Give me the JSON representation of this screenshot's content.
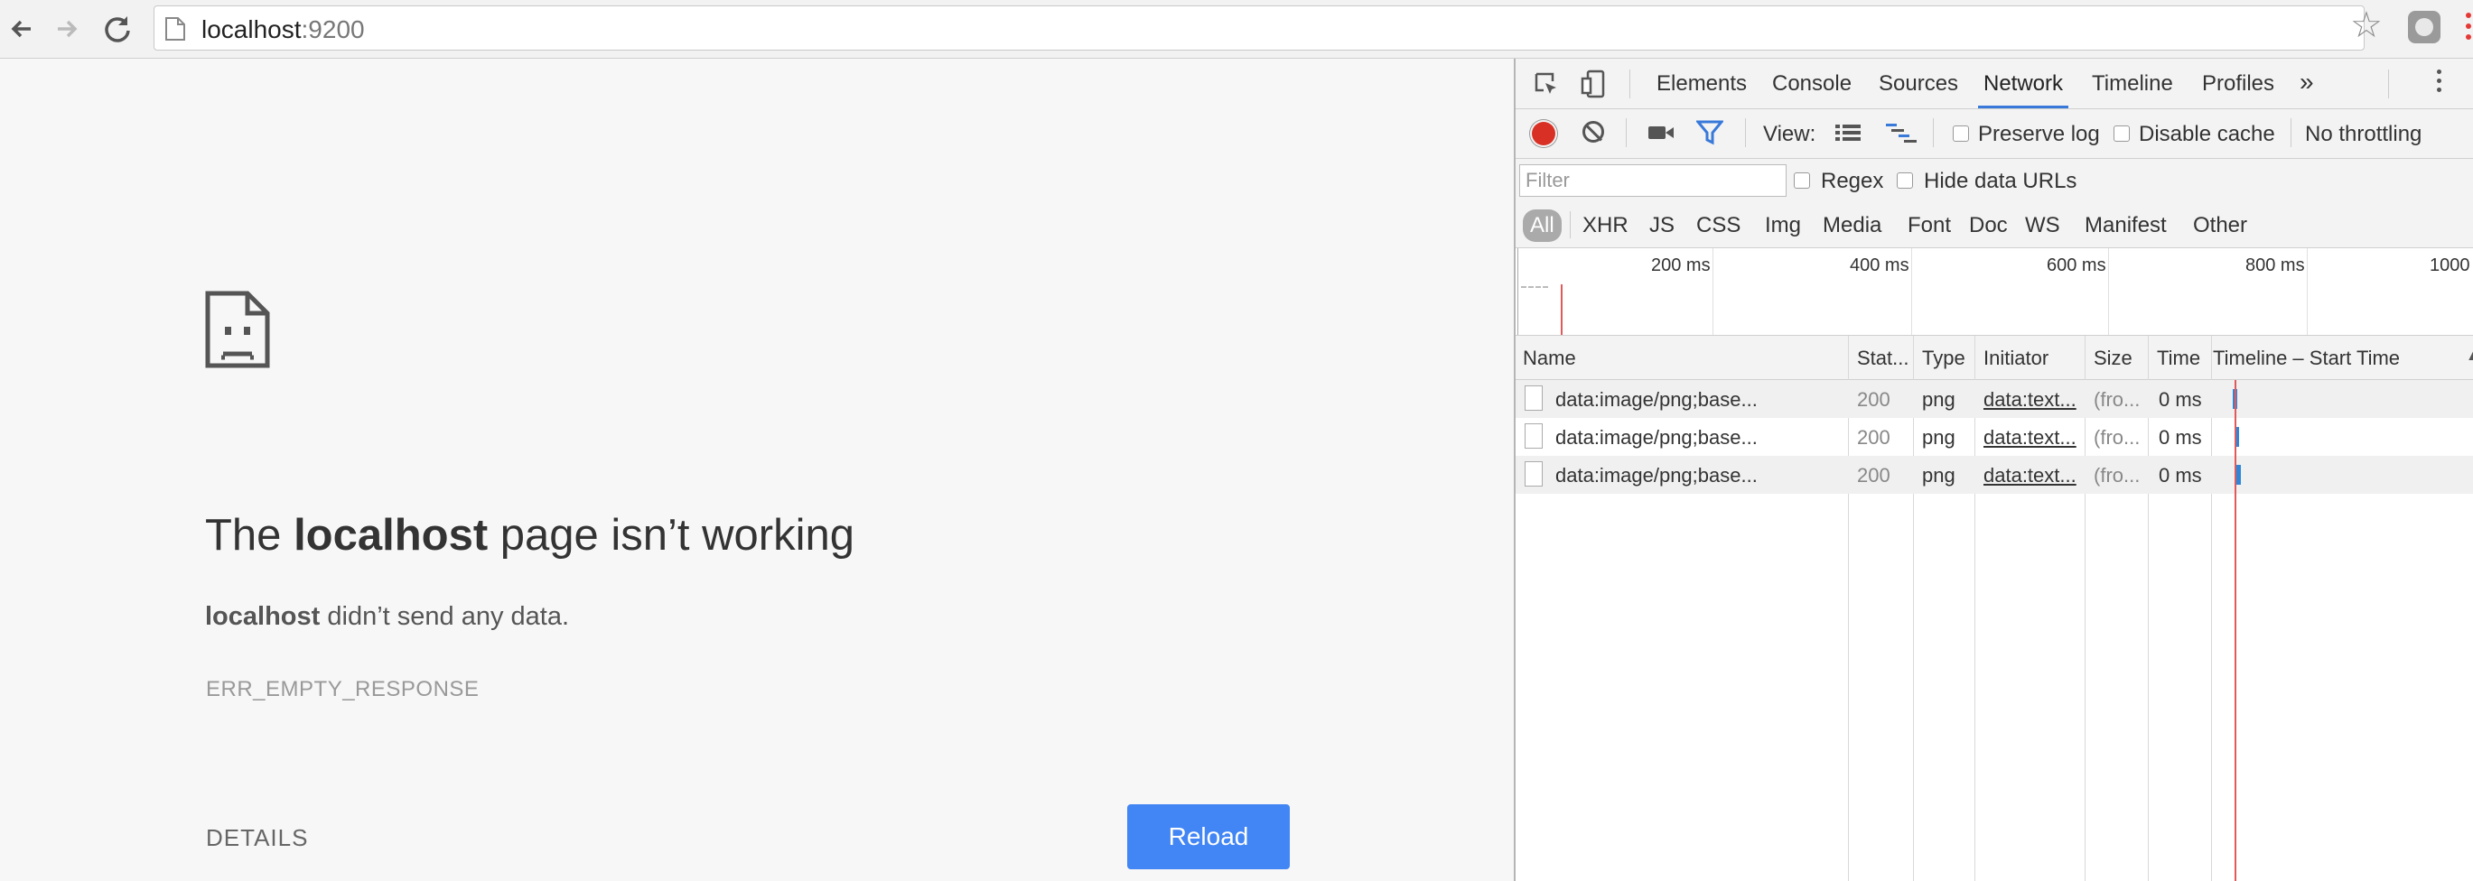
{
  "browser": {
    "url_host": "localhost",
    "url_port": ":9200"
  },
  "error_page": {
    "title_prefix": "The ",
    "title_bold": "localhost",
    "title_suffix": " page isn’t working",
    "subtitle_bold": "localhost",
    "subtitle_rest": " didn’t send any data.",
    "error_code": "ERR_EMPTY_RESPONSE",
    "details_label": "DETAILS",
    "reload_label": "Reload"
  },
  "devtools": {
    "tabs": [
      "Elements",
      "Console",
      "Sources",
      "Network",
      "Timeline",
      "Profiles"
    ],
    "active_tab": "Network",
    "more_tabs_glyph": "»",
    "toolbar": {
      "view_label": "View:",
      "preserve_log": "Preserve log",
      "disable_cache": "Disable cache",
      "throttling": "No throttling"
    },
    "filter": {
      "placeholder": "Filter",
      "regex": "Regex",
      "hide_data_urls": "Hide data URLs"
    },
    "types": [
      "All",
      "XHR",
      "JS",
      "CSS",
      "Img",
      "Media",
      "Font",
      "Doc",
      "WS",
      "Manifest",
      "Other"
    ],
    "active_type": "All",
    "overview_ticks": [
      "200 ms",
      "400 ms",
      "600 ms",
      "800 ms",
      "1000"
    ],
    "columns": [
      "Name",
      "Stat...",
      "Type",
      "Initiator",
      "Size",
      "Time",
      "Timeline – Start Time"
    ],
    "rows": [
      {
        "name": "data:image/png;base...",
        "status": "200",
        "type": "png",
        "initiator": "data:text...",
        "size": "(fro...",
        "time": "0 ms"
      },
      {
        "name": "data:image/png;base...",
        "status": "200",
        "type": "png",
        "initiator": "data:text...",
        "size": "(fro...",
        "time": "0 ms"
      },
      {
        "name": "data:image/png;base...",
        "status": "200",
        "type": "png",
        "initiator": "data:text...",
        "size": "(fro...",
        "time": "0 ms"
      }
    ]
  },
  "colors": {
    "reload_button": "#4285f4",
    "record_red": "#d93025",
    "active_tab_underline": "#3879d9",
    "timeline_bar": "#2f86d8"
  }
}
